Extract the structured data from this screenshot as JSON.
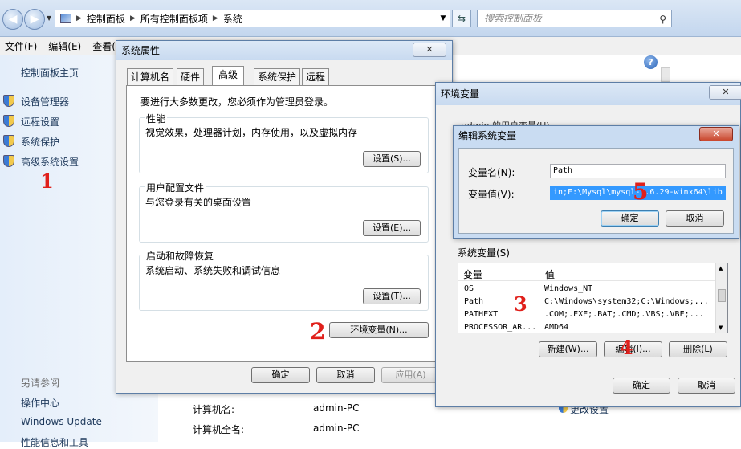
{
  "explorer": {
    "breadcrumb": [
      "控制面板",
      "所有控制面板项",
      "系统"
    ],
    "search_placeholder": "搜索控制面板",
    "menu": [
      "文件(F)",
      "编辑(E)",
      "查看("
    ],
    "left_pane": {
      "home": "控制面板主页",
      "links": [
        "设备管理器",
        "远程设置",
        "系统保护",
        "高级系统设置"
      ],
      "see_also": "另请参阅",
      "see_also_links": [
        "操作中心",
        "Windows Update",
        "性能信息和工具"
      ]
    },
    "computer_name_label": "计算机名:",
    "computer_name_value": "admin-PC",
    "computer_fullname_label": "计算机全名:",
    "computer_fullname_value": "admin-PC",
    "change_settings": "更改设置"
  },
  "sysprops": {
    "title": "系统属性",
    "close": "✕",
    "tabs": [
      "计算机名",
      "硬件",
      "高级",
      "系统保护",
      "远程"
    ],
    "admin_note": "要进行大多数更改，您必须作为管理员登录。",
    "perf_title": "性能",
    "perf_desc": "视觉效果，处理器计划，内存使用，以及虚拟内存",
    "perf_btn": "设置(S)...",
    "profile_title": "用户配置文件",
    "profile_desc": "与您登录有关的桌面设置",
    "profile_btn": "设置(E)...",
    "startup_title": "启动和故障恢复",
    "startup_desc": "系统启动、系统失败和调试信息",
    "startup_btn": "设置(T)...",
    "env_btn": "环境变量(N)...",
    "ok": "确定",
    "cancel": "取消",
    "apply": "应用(A)"
  },
  "envvars": {
    "title": "环境变量",
    "close": "✕",
    "user_vars_partial": "admin 的用户变量(U)",
    "sys_vars_label": "系统变量(S)",
    "col_var": "变量",
    "col_val": "值",
    "rows": [
      {
        "name": "OS",
        "value": "Windows_NT"
      },
      {
        "name": "Path",
        "value": "C:\\Windows\\system32;C:\\Windows;..."
      },
      {
        "name": "PATHEXT",
        "value": ".COM;.EXE;.BAT;.CMD;.VBS;.VBE;..."
      },
      {
        "name": "PROCESSOR_AR...",
        "value": "AMD64"
      }
    ],
    "new_btn": "新建(W)...",
    "edit_btn": "编辑(I)...",
    "delete_btn": "删除(L)",
    "ok": "确定",
    "cancel": "取消"
  },
  "editvar": {
    "title": "编辑系统变量",
    "close": "✕",
    "name_label": "变量名(N):",
    "name_value": "Path",
    "value_label": "变量值(V):",
    "value_value": "in;F:\\Mysql\\mysql-5.6.29-winx64\\lib",
    "ok": "确定",
    "cancel": "取消"
  },
  "annotations": [
    "1",
    "2",
    "3",
    "4",
    "5"
  ]
}
